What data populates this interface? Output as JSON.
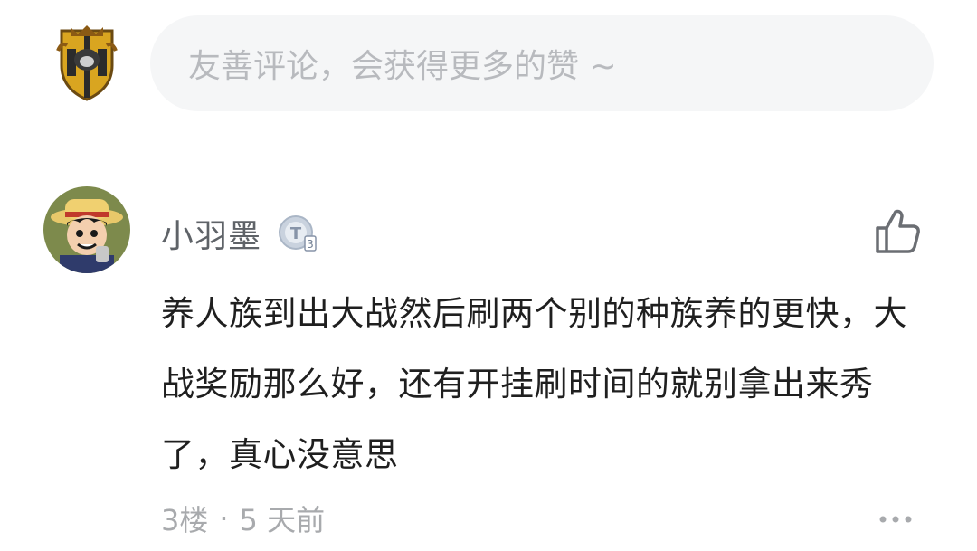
{
  "composer": {
    "placeholder": "友善评论，会获得更多的赞 ~",
    "avatar_icon": "house-crest-icon"
  },
  "comment": {
    "author": "小羽墨",
    "level_badge": "T3",
    "avatar_icon": "anime-avatar-icon",
    "body": "养人族到出大战然后刷两个别的种族养的更快，大战奖励那么好，还有开挂刷时间的就别拿出来秀了，真心没意思",
    "floor": "3楼",
    "separator": "·",
    "time": "5 天前",
    "like_icon": "thumbs-up-icon",
    "more_icon": "more-dots-icon"
  },
  "colors": {
    "input_bg": "#f5f6f7",
    "placeholder": "#b8babe",
    "author": "#5f6368",
    "body_text": "#1f1f1f",
    "meta": "#a8aaad"
  }
}
